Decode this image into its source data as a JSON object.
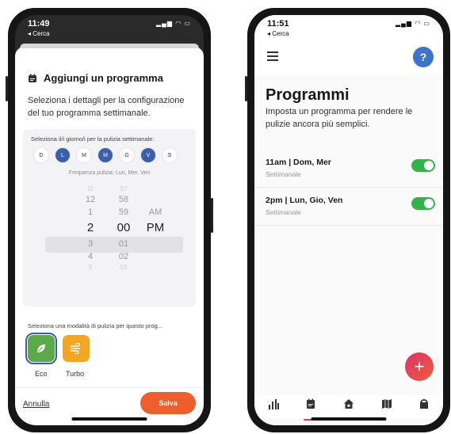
{
  "left": {
    "status": {
      "time": "11:49",
      "back": "◂ Cerca"
    },
    "title": "Aggiungi un programma",
    "description": "Seleziona i dettagli per la configurazione del tuo programma settimanale.",
    "days_label": "Seleziona il/i giorno/i per la pulizia settimanale:",
    "days": [
      {
        "label": "D",
        "selected": false
      },
      {
        "label": "L",
        "selected": true
      },
      {
        "label": "M",
        "selected": false
      },
      {
        "label": "M",
        "selected": true
      },
      {
        "label": "G",
        "selected": false
      },
      {
        "label": "V",
        "selected": true
      },
      {
        "label": "S",
        "selected": false
      }
    ],
    "frequency_prefix": "Frequenza pulizia:",
    "frequency_value": "Lun, Mer, Ven",
    "picker": {
      "hours": [
        "11",
        "12",
        "1",
        "2",
        "3",
        "4",
        "5"
      ],
      "minutes": [
        "57",
        "58",
        "59",
        "00",
        "01",
        "02",
        "03"
      ],
      "ampm": [
        "AM",
        "PM"
      ],
      "selected": {
        "hour": "2",
        "minute": "00",
        "ampm": "PM"
      }
    },
    "mode_label": "Seleziona una modalità di pulizia per questo prog...",
    "modes": [
      {
        "name": "Eco",
        "selected": true,
        "color": "#5ca94a"
      },
      {
        "name": "Turbo",
        "selected": false,
        "color": "#f2a623"
      }
    ],
    "cancel": "Annulla",
    "save": "Salva"
  },
  "right": {
    "status": {
      "time": "11:51",
      "back": "◂ Cerca"
    },
    "help": "?",
    "title": "Programmi",
    "description": "Imposta un programma per rendere le pulizie ancora più semplici.",
    "schedules": [
      {
        "time": "11am | Dom, Mer",
        "freq": "Settimanale",
        "enabled": true
      },
      {
        "time": "2pm | Lun, Gio, Ven",
        "freq": "Settimanale",
        "enabled": true
      }
    ],
    "fab": "+",
    "tabs": [
      "stats-icon",
      "schedule-icon",
      "home-icon",
      "map-icon",
      "robot-icon"
    ],
    "active_tab": "schedule-icon"
  },
  "colors": {
    "accent_blue": "#3b5fa8",
    "save_orange": "#ef5e2d",
    "toggle_green": "#36b24a",
    "fab_pink": "#d8366a"
  }
}
